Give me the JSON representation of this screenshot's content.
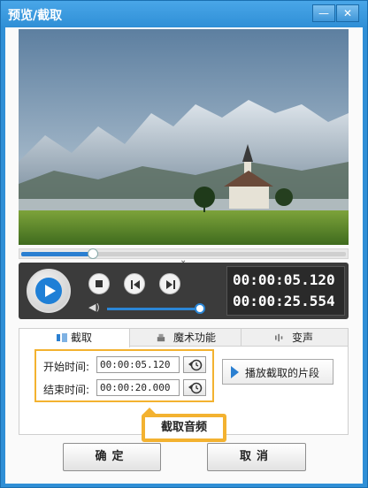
{
  "window": {
    "title": "预览/截取",
    "minimize_icon": "minimize-icon",
    "close_icon": "close-icon"
  },
  "player": {
    "seek_progress": 0.22,
    "volume_level": 0.95,
    "current_time": "00:00:05.120",
    "total_time": "00:00:25.554"
  },
  "tabs": [
    {
      "label": "截取",
      "icon": "cut-icon",
      "active": true
    },
    {
      "label": "魔术功能",
      "icon": "magic-icon",
      "active": false
    },
    {
      "label": "变声",
      "icon": "voice-change-icon",
      "active": false
    }
  ],
  "clip": {
    "start_label": "开始时间:",
    "start_value": "00:00:05.120",
    "end_label": "结束时间:",
    "end_value": "00:00:20.000",
    "play_segment_label": "播放截取的片段"
  },
  "callout": {
    "text": "截取音频",
    "color": "#f3b230"
  },
  "buttons": {
    "ok": "确定",
    "cancel": "取消"
  },
  "colors": {
    "accent": "#2a7fd1",
    "titlebar": "#2f8fd6"
  }
}
